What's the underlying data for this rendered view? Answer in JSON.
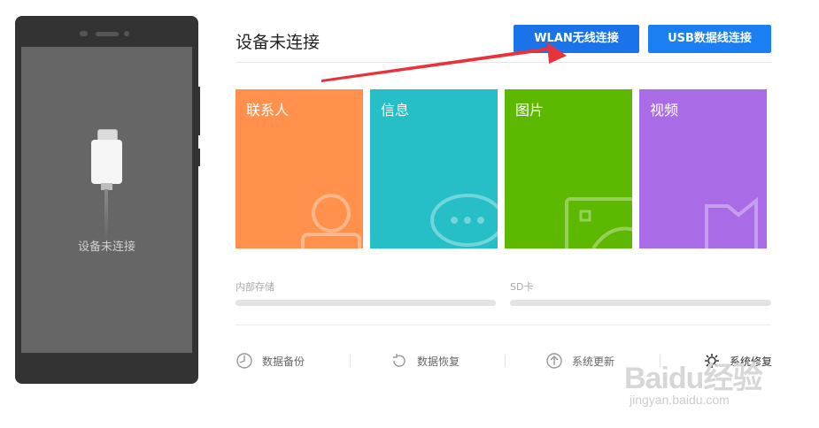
{
  "phone": {
    "screen_label": "设备未连接"
  },
  "header": {
    "title": "设备未连接"
  },
  "buttons": {
    "wlan": "WLAN无线连接",
    "usb": "USB数据线连接"
  },
  "tiles": [
    {
      "label": "联系人",
      "color": "#ff914d",
      "icon": "contact-icon"
    },
    {
      "label": "信息",
      "color": "#26bfc7",
      "icon": "message-icon"
    },
    {
      "label": "图片",
      "color": "#5cb800",
      "icon": "picture-icon"
    },
    {
      "label": "视频",
      "color": "#a96be6",
      "icon": "video-icon"
    }
  ],
  "storage": {
    "internal": "内部存储",
    "sd": "SD卡"
  },
  "tools": [
    {
      "label": "数据备份",
      "icon": "backup-icon"
    },
    {
      "label": "数据恢复",
      "icon": "restore-icon"
    },
    {
      "label": "系统更新",
      "icon": "update-icon"
    },
    {
      "label": "系统修复",
      "icon": "repair-icon"
    }
  ],
  "watermark": {
    "logo": "Baidu经验",
    "url": "jingyan.baidu.com"
  }
}
